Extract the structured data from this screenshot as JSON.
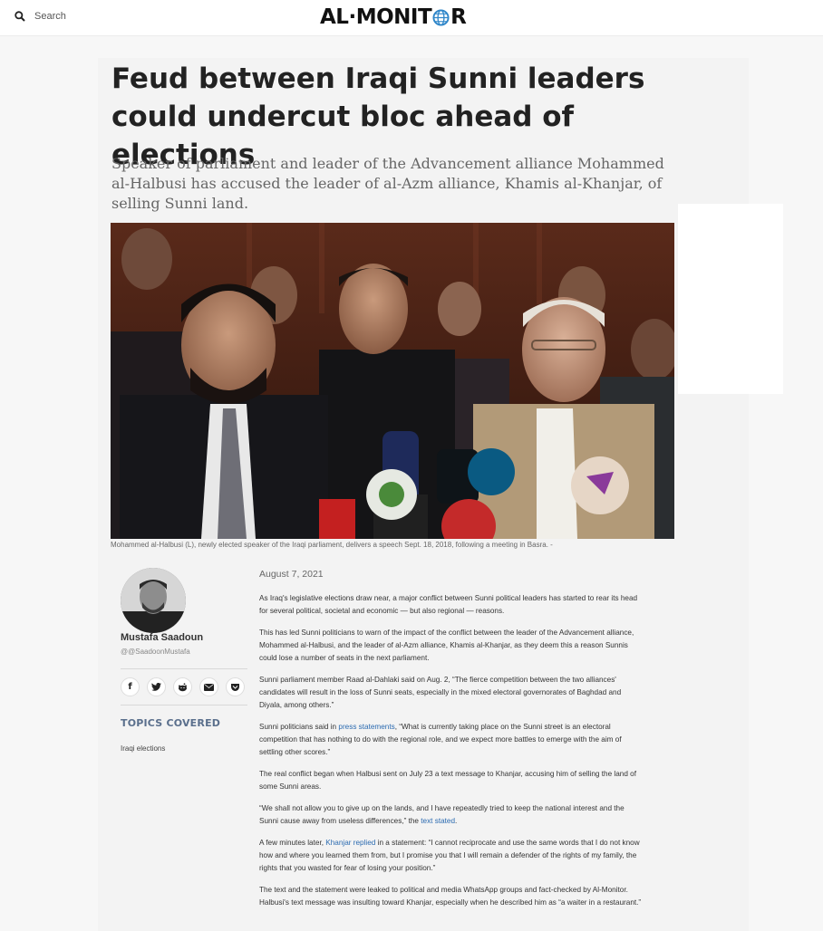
{
  "header": {
    "search_placeholder": "Search",
    "logo_left": "AL·MONIT",
    "logo_right": "R"
  },
  "article": {
    "headline": "Feud between Iraqi Sunni leaders could undercut bloc ahead of elections",
    "dek": "Speaker of parliament and leader of the Advancement alliance Mohammed al-Halbusi has accused the leader of al-Azm alliance, Khamis al-Khanjar, of selling Sunni land.",
    "caption": "Mohammed al-Halbusi (L), newly elected speaker of the Iraqi parliament, delivers a speech Sept. 18, 2018, following a meeting in Basra. -",
    "date": "August 7, 2021",
    "paragraphs": {
      "p1": "As Iraq's legislative elections draw near, a major conflict between Sunni political leaders has started to rear its head for several political, societal and economic — but also regional — reasons.",
      "p2": "This has led Sunni politicians to warn of the impact of the conflict between the leader of the Advancement alliance, Mohammed al-Halbusi, and the leader of al-Azm alliance, Khamis al-Khanjar, as they deem this a reason Sunnis could lose a number of seats in the next parliament.",
      "p3": "Sunni parliament member Raad al-Dahlaki said on Aug. 2, “The fierce competition between the two alliances' candidates will result in the loss of Sunni seats, especially in the mixed electoral governorates of Baghdad and Diyala, among others.”",
      "p4_a": "Sunni politicians said in ",
      "p4_link": "press statements",
      "p4_b": ", “What is currently taking place on the Sunni street is an electoral competition that has nothing to do with the regional role, and we expect more battles to emerge with the aim of settling other scores.”",
      "p5": "The real conflict began when Halbusi sent on July 23 a text message to Khanjar, accusing him of selling the land of some Sunni areas.",
      "p6_a": "“We shall not allow you to give up on the lands, and I have repeatedly tried to keep the national interest and the Sunni cause away from useless differences,” the ",
      "p6_link": "text stated",
      "p6_b": ".",
      "p7_a": "A few minutes later, ",
      "p7_link": "Khanjar replied",
      "p7_b": " in a statement: “I cannot reciprocate and use the same words that I do not know how and where you learned them from, but I promise you that I will remain a defender of the rights of my family, the rights that you wasted for fear of losing your position.”",
      "p8": "The text and the statement were leaked to political and media WhatsApp groups and fact-checked by Al-Monitor. Halbusi's text message was insulting toward Khanjar, especially when he described him as “a waiter in a restaurant.”"
    }
  },
  "author": {
    "name": "Mustafa Saadoun",
    "handle": "@@SaadoonMustafa"
  },
  "share": {
    "facebook": "f",
    "twitter": "t",
    "reddit": "r",
    "email": "✉",
    "pocket": "p"
  },
  "topics": {
    "title": "TOPICS COVERED",
    "items": [
      "Iraqi elections"
    ]
  },
  "colors": {
    "link": "#2a6ab0",
    "topics_title": "#5a6f8c",
    "logo_globe": "#2f86c9"
  }
}
